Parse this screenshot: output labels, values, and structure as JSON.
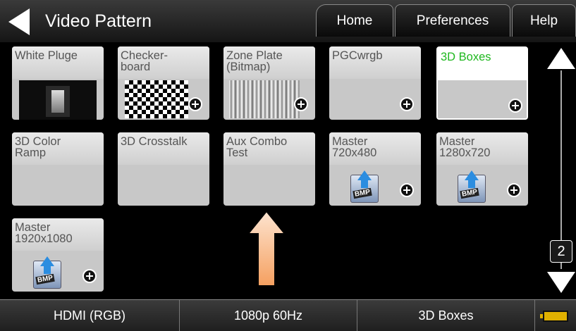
{
  "header": {
    "title": "Video Pattern",
    "tabs": [
      "Home",
      "Preferences",
      "Help"
    ]
  },
  "tiles": [
    {
      "label": "White Pluge",
      "thumb": "pluge",
      "add": false
    },
    {
      "label": "Checker-\nboard",
      "thumb": "checker",
      "add": true
    },
    {
      "label": "Zone Plate\n(Bitmap)",
      "thumb": "zone-plate",
      "add": true
    },
    {
      "label": "PGCwrgb",
      "thumb": "none",
      "add": true
    },
    {
      "label": "3D Boxes",
      "thumb": "none",
      "add": true,
      "selected": true
    },
    {
      "label": "3D Color\nRamp",
      "thumb": "none",
      "add": false
    },
    {
      "label": "3D Crosstalk",
      "thumb": "none",
      "add": false
    },
    {
      "label": "Aux Combo\nTest",
      "thumb": "none",
      "add": false
    },
    {
      "label": "Master\n720x480",
      "thumb": "bmp",
      "add": true
    },
    {
      "label": "Master\n1280x720",
      "thumb": "bmp",
      "add": true
    },
    {
      "label": "Master\n1920x1080",
      "thumb": "bmp",
      "add": true
    }
  ],
  "bmp_icon_text": "BMP",
  "page_indicator": "2",
  "status": {
    "interface": "HDMI (RGB)",
    "format": "1080p 60Hz",
    "pattern": "3D Boxes"
  },
  "colors": {
    "selected_label": "#1fb81f",
    "arrow": "#f5a86a",
    "battery": "#e0b000"
  }
}
